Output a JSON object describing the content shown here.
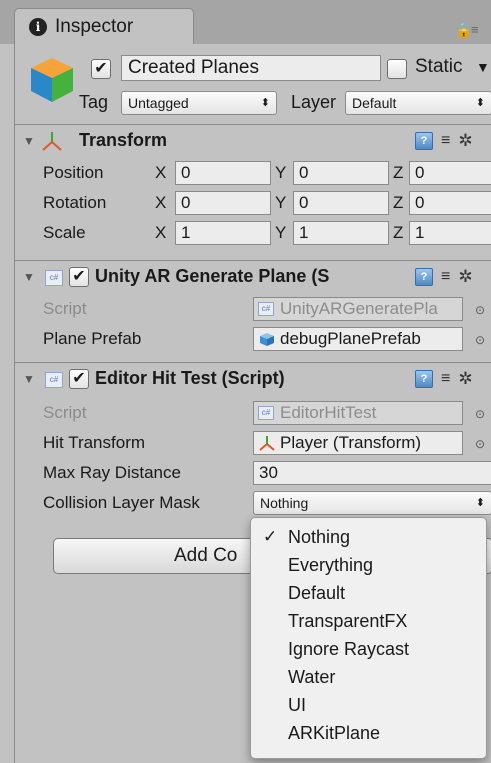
{
  "tab": {
    "title": "Inspector"
  },
  "gameobject": {
    "name": "Created Planes",
    "static_label": "Static",
    "tag_label": "Tag",
    "tag_value": "Untagged",
    "layer_label": "Layer",
    "layer_value": "Default"
  },
  "transform": {
    "title": "Transform",
    "rows": [
      {
        "label": "Position",
        "x": "0",
        "y": "0",
        "z": "0"
      },
      {
        "label": "Rotation",
        "x": "0",
        "y": "0",
        "z": "0"
      },
      {
        "label": "Scale",
        "x": "1",
        "y": "1",
        "z": "1"
      }
    ],
    "axes": {
      "x": "X",
      "y": "Y",
      "z": "Z"
    }
  },
  "generate_plane": {
    "title": "Unity AR Generate Plane (S",
    "script_label": "Script",
    "script_value": "UnityARGeneratePla",
    "prefab_label": "Plane Prefab",
    "prefab_value": "debugPlanePrefab"
  },
  "hit_test": {
    "title": "Editor Hit Test (Script)",
    "script_label": "Script",
    "script_value": "EditorHitTest",
    "hit_transform_label": "Hit Transform",
    "hit_transform_value": "Player (Transform)",
    "max_ray_label": "Max Ray Distance",
    "max_ray_value": "30",
    "mask_label": "Collision Layer Mask",
    "mask_value": "Nothing"
  },
  "add_component": {
    "label": "Add Co"
  },
  "layer_menu": {
    "items": [
      {
        "label": "Nothing",
        "checked": true
      },
      {
        "label": "Everything",
        "checked": false
      },
      {
        "label": "Default",
        "checked": false
      },
      {
        "label": "TransparentFX",
        "checked": false
      },
      {
        "label": "Ignore Raycast",
        "checked": false
      },
      {
        "label": "Water",
        "checked": false
      },
      {
        "label": "UI",
        "checked": false
      },
      {
        "label": "ARKitPlane",
        "checked": false
      }
    ]
  },
  "icons": {
    "check": "✓",
    "checkmark_box": "✔",
    "arrows": "⬍",
    "fold": "▼",
    "picker": "⊙",
    "gear": "✲",
    "cs": "c#",
    "book": "?"
  },
  "colors": {
    "panel_bg": "#c2c2c2",
    "field_bg": "#ececec",
    "menu_bg": "#f0f0f0"
  }
}
